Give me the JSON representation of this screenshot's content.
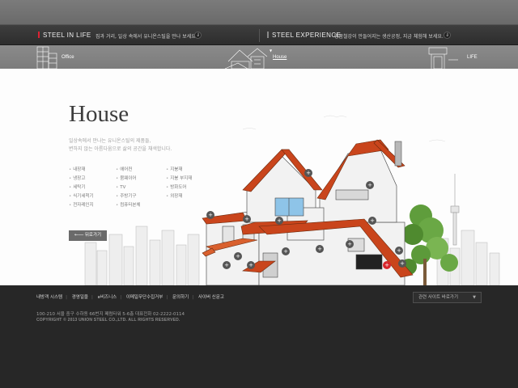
{
  "nav": {
    "left": {
      "brand": "STEEL IN LIFE",
      "desc": "집과 거리, 일상 속에서 유니온스틸을 만나 보세요."
    },
    "right": {
      "brand": "STEEL EXPERIENCE",
      "desc": "명품철강이 만들어지는 생산공정,  지금 체험해 보세요."
    },
    "arrow_glyph": "⇓"
  },
  "strip": {
    "office": "Office",
    "house": "House",
    "life": "LIFE",
    "marker": "▼"
  },
  "main": {
    "title": "House",
    "desc_lines": [
      "일상속에서 만나는 유니온스틸의 제품들,",
      "변하지 않는 아름다움으로 삶의 공간을 채색합니다."
    ],
    "items": [
      "내장재",
      "에어컨",
      "지붕재",
      "냉장고",
      "뭄웨이어",
      "지붕 부지재",
      "세탁기",
      "TV",
      "방화도어",
      "식기세척기",
      "주방기구",
      "외장재",
      "전자레인지",
      "컴퓨터본체"
    ],
    "back_button": "←── 뒤로가기",
    "hotspot_glyph": "+"
  },
  "footer": {
    "links": [
      "내방객 시스템",
      "경영일을",
      "e비즈니스",
      "이메일무단수집거부",
      "문의하기",
      "사이버 신문고"
    ],
    "link_sep": "|",
    "address": "100-210 서울 중구 수하동 66번지 페럼타워 5-6층 대표전화 02-2222-0114",
    "copyright": "COPYRIGHT © 2013 UNION STEEL CO.,LTD.  ALL RIGHTS RESERVED.",
    "related_sites": "관련 사이트 바로가기",
    "caret": "▼"
  },
  "colors": {
    "accent_red": "#d9262c",
    "roof": "#c9451c",
    "footer_bg": "#272727"
  }
}
